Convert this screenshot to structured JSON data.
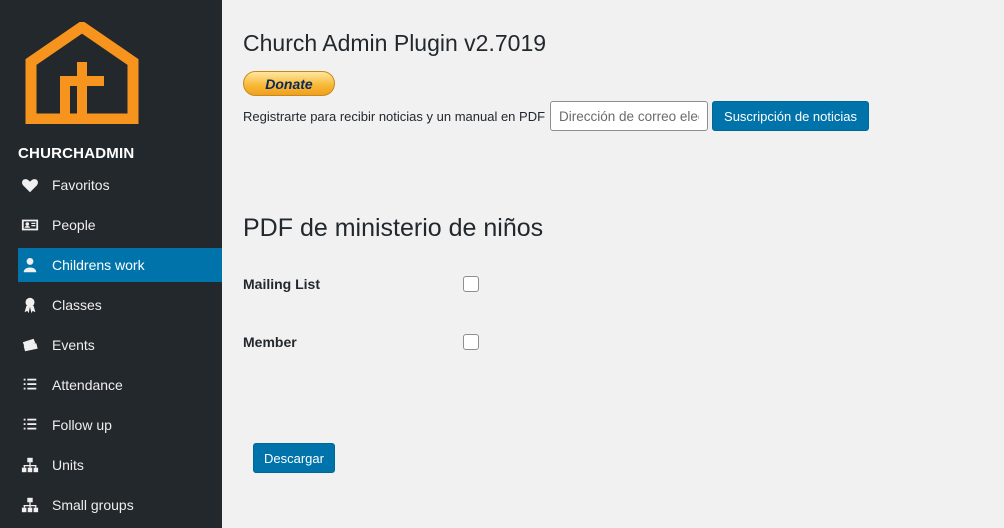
{
  "sidebar": {
    "brand": "CHURCHADMIN",
    "items": [
      {
        "label": "Favoritos",
        "icon": "heart-icon"
      },
      {
        "label": "People",
        "icon": "id-card-icon"
      },
      {
        "label": "Childrens work",
        "icon": "person-icon"
      },
      {
        "label": "Classes",
        "icon": "award-icon"
      },
      {
        "label": "Events",
        "icon": "tickets-icon"
      },
      {
        "label": "Attendance",
        "icon": "list-icon"
      },
      {
        "label": "Follow up",
        "icon": "list-icon"
      },
      {
        "label": "Units",
        "icon": "hierarchy-icon"
      },
      {
        "label": "Small groups",
        "icon": "hierarchy-icon"
      }
    ],
    "active_index": 2
  },
  "main": {
    "title": "Church Admin Plugin v2.7019",
    "donate_label": "Donate",
    "newsletter": {
      "label": "Registrarte para recibir noticias y un manual en PDF",
      "placeholder": "Dirección de correo electrónico",
      "button_label": "Suscripción de noticias"
    },
    "section_title": "PDF de ministerio de niños",
    "fields": [
      {
        "label": "Mailing List",
        "checked": false
      },
      {
        "label": "Member",
        "checked": false
      }
    ],
    "download_label": "Descargar"
  },
  "colors": {
    "sidebar_bg": "#23282d",
    "active_bg": "#0073aa",
    "logo": "#f7941d",
    "button": "#0073aa",
    "page_bg": "#f1f1f1"
  }
}
